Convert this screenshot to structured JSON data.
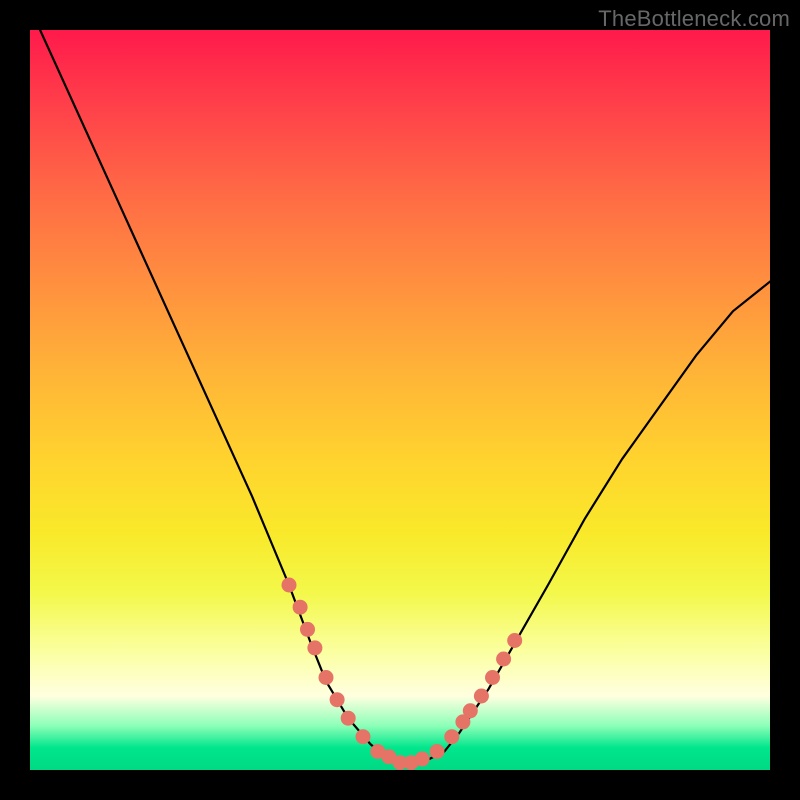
{
  "watermark": "TheBottleneck.com",
  "colors": {
    "frame": "#000000",
    "curve": "#000000",
    "dots": "#e57366",
    "gradient_top": "#ff1a4b",
    "gradient_bottom": "#00d985"
  },
  "chart_data": {
    "type": "line",
    "title": "",
    "xlabel": "",
    "ylabel": "",
    "xlim": [
      0,
      100
    ],
    "ylim": [
      0,
      100
    ],
    "grid": false,
    "legend": false,
    "series": [
      {
        "name": "bottleneck-curve",
        "x": [
          0,
          5,
          10,
          15,
          20,
          25,
          30,
          35,
          38,
          40,
          43,
          46,
          48,
          50,
          52,
          54,
          56,
          58,
          62,
          66,
          70,
          75,
          80,
          85,
          90,
          95,
          100
        ],
        "y": [
          103,
          92,
          81,
          70,
          59,
          48,
          37,
          25,
          17,
          12,
          7,
          3.5,
          1.8,
          1,
          1,
          1.5,
          2.5,
          5,
          11,
          18,
          25,
          34,
          42,
          49,
          56,
          62,
          66
        ]
      }
    ],
    "marker_points": {
      "name": "highlighted-dots",
      "x": [
        35,
        36.5,
        37.5,
        38.5,
        40,
        41.5,
        43,
        45,
        47,
        48.5,
        50,
        51.5,
        53,
        55,
        57,
        58.5,
        59.5,
        61,
        62.5,
        64,
        65.5
      ],
      "y": [
        25,
        22,
        19,
        16.5,
        12.5,
        9.5,
        7,
        4.5,
        2.5,
        1.8,
        1,
        1,
        1.5,
        2.5,
        4.5,
        6.5,
        8,
        10,
        12.5,
        15,
        17.5
      ]
    }
  }
}
